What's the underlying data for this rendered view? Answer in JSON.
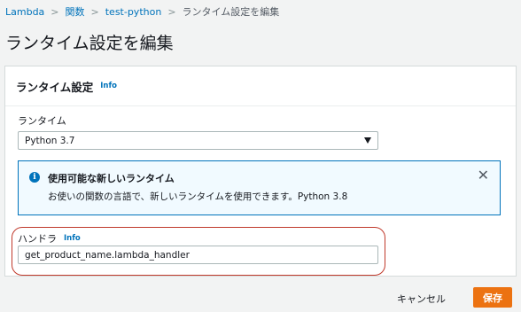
{
  "breadcrumb": {
    "items": [
      "Lambda",
      "関数",
      "test-python"
    ],
    "current": "ランタイム設定を編集"
  },
  "page": {
    "title": "ランタイム設定を編集"
  },
  "panel": {
    "title": "ランタイム設定",
    "info_label": "Info"
  },
  "runtime": {
    "label": "ランタイム",
    "selected": "Python 3.7"
  },
  "alert": {
    "title": "使用可能な新しいランタイム",
    "body": "お使いの関数の言語で、新しいランタイムを使用できます。Python 3.8"
  },
  "handler": {
    "label": "ハンドラ",
    "info_label": "Info",
    "value": "get_product_name.lambda_handler"
  },
  "actions": {
    "cancel": "キャンセル",
    "save": "保存"
  },
  "colors": {
    "link": "#0073bb",
    "primary_button": "#ec7211",
    "alert_border": "#0073bb",
    "alert_background": "#f1faff",
    "highlight": "#c0392b"
  },
  "icons": {
    "separator": "chevron-right-icon",
    "alert": "info-icon",
    "close": "close-icon",
    "dropdown": "caret-down-icon"
  }
}
